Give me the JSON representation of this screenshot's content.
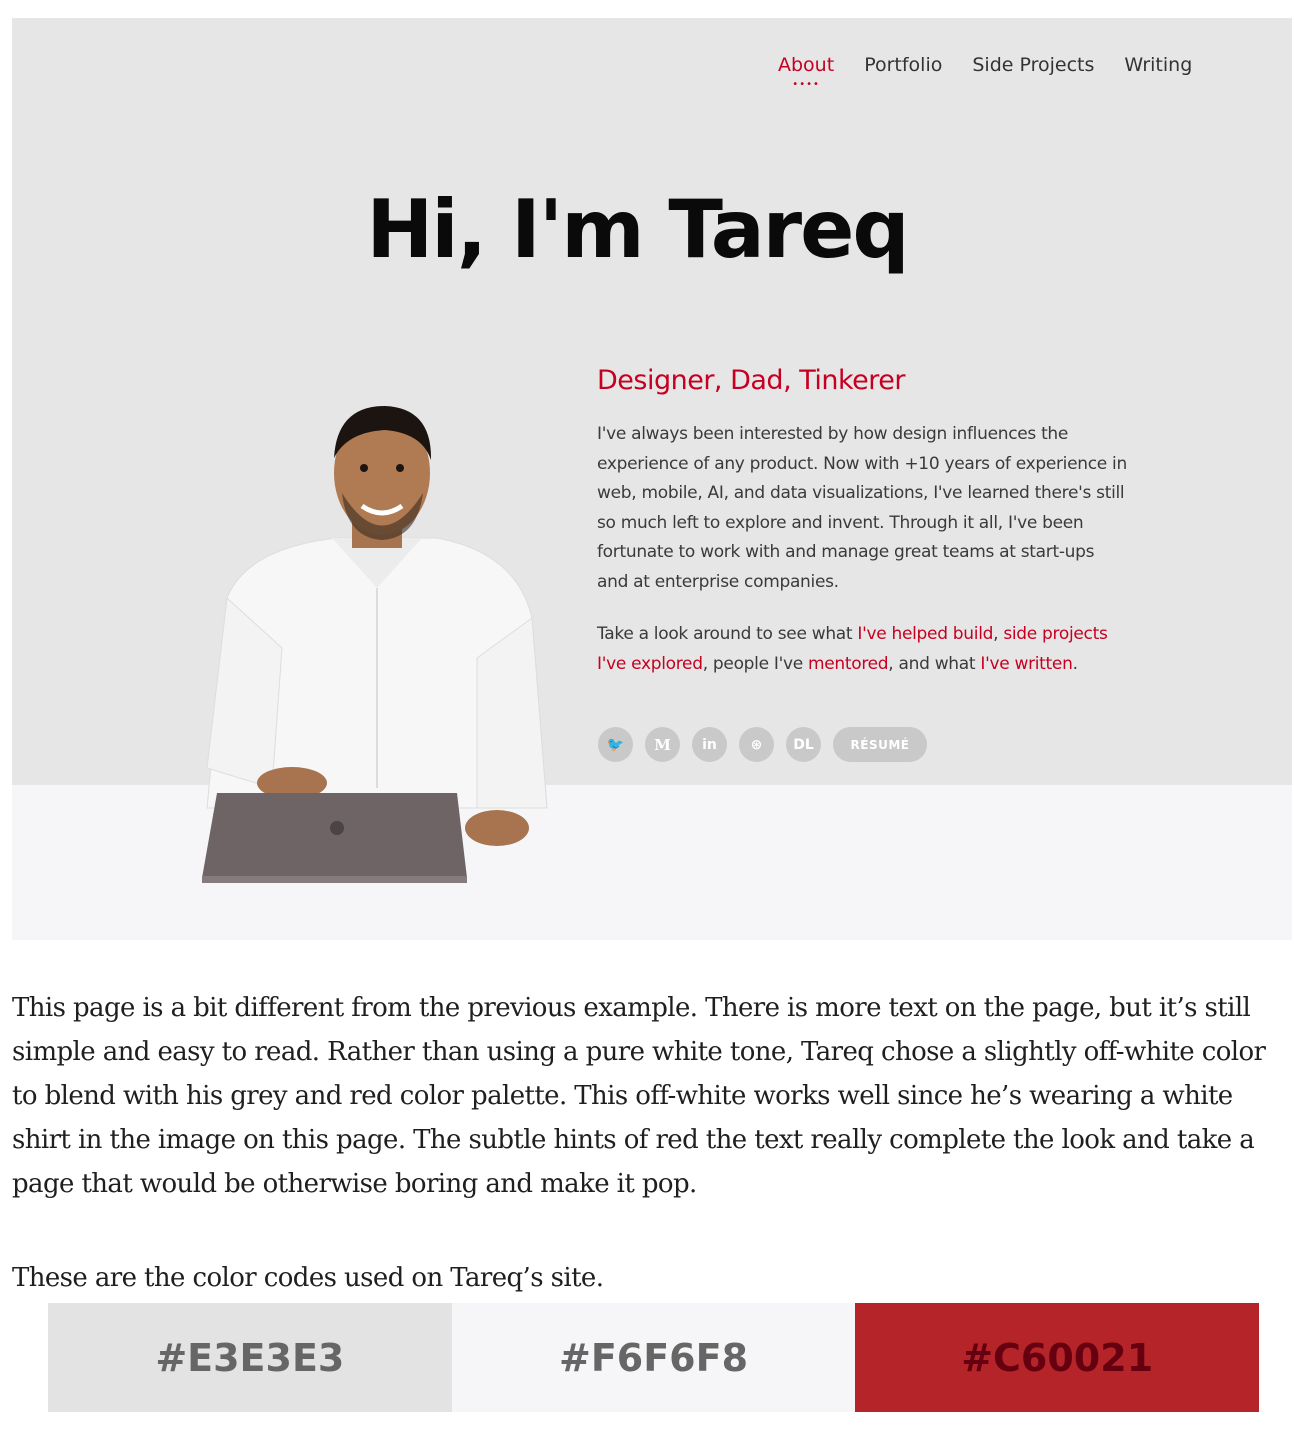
{
  "nav": {
    "items": [
      {
        "label": "About",
        "active": true
      },
      {
        "label": "Portfolio",
        "active": false
      },
      {
        "label": "Side Projects",
        "active": false
      },
      {
        "label": "Writing",
        "active": false
      }
    ],
    "active_dots": "••••"
  },
  "hero": {
    "title": "Hi, I'm Tareq",
    "tagline": "Designer, Dad, Tinkerer",
    "bio": "I've always been interested by how design influences the experience of any product. Now with +10 years of experience in web, mobile, AI, and data visualizations, I've learned there's still so much left to explore and invent. Through it all, I've been fortunate to work with and manage great teams at start-ups and at enterprise companies.",
    "cta": {
      "prefix": "Take a look around to see what ",
      "link1": "I've helped build",
      "sep1": ", ",
      "link2": "side projects I've explored",
      "sep2": ", people I've ",
      "link3": "mentored",
      "sep3": ", and what ",
      "link4": "I've written",
      "suffix": "."
    }
  },
  "socials": {
    "twitter": "🐦",
    "medium": "M",
    "linkedin": "in",
    "dribbble": "⊛",
    "dl": "DL",
    "resume": "RÉSUMÉ"
  },
  "article": {
    "paragraph1": "This page is a bit different from the previous example. There is more text on the page, but it’s still simple and easy to read. Rather than using a pure white tone, Tareq chose a slightly off-white color to blend with his grey and red color palette. This off-white works well since he’s wearing a white shirt in the image on this page. The subtle hints of red the text really complete the look and take a page that would be otherwise boring and make it pop.",
    "paragraph2": "These are the color codes used on Tareq’s site."
  },
  "swatches": [
    {
      "code": "#E3E3E3",
      "color": "#E3E3E3"
    },
    {
      "code": "#F6F6F8",
      "color": "#F6F6F8"
    },
    {
      "code": "#C60021",
      "color": "#C60021"
    }
  ],
  "colors": {
    "accent": "#c60021",
    "hero_bg": "#e6e6e6",
    "off_white": "#f6f6f8"
  }
}
